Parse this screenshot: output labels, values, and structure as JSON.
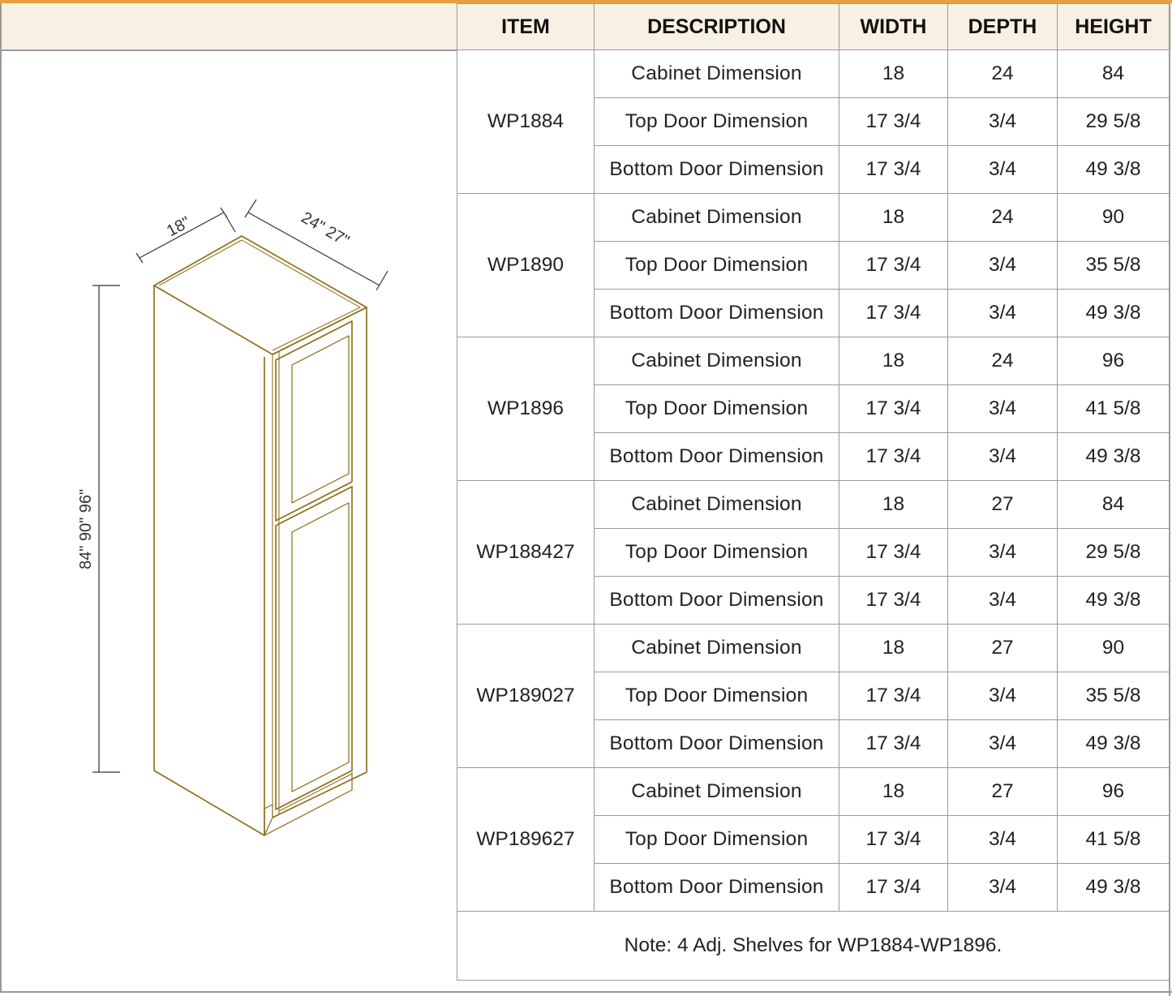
{
  "table": {
    "headers": {
      "item": "ITEM",
      "description": "DESCRIPTION",
      "width": "WIDTH",
      "depth": "DEPTH",
      "height": "HEIGHT"
    },
    "groups": [
      {
        "item": "WP1884",
        "rows": [
          {
            "description": "Cabinet Dimension",
            "width": "18",
            "depth": "24",
            "height": "84"
          },
          {
            "description": "Top Door Dimension",
            "width": "17 3/4",
            "depth": "3/4",
            "height": "29 5/8"
          },
          {
            "description": "Bottom Door Dimension",
            "width": "17 3/4",
            "depth": "3/4",
            "height": "49 3/8"
          }
        ]
      },
      {
        "item": "WP1890",
        "rows": [
          {
            "description": "Cabinet Dimension",
            "width": "18",
            "depth": "24",
            "height": "90"
          },
          {
            "description": "Top Door Dimension",
            "width": "17 3/4",
            "depth": "3/4",
            "height": "35 5/8"
          },
          {
            "description": "Bottom Door Dimension",
            "width": "17 3/4",
            "depth": "3/4",
            "height": "49 3/8"
          }
        ]
      },
      {
        "item": "WP1896",
        "rows": [
          {
            "description": "Cabinet Dimension",
            "width": "18",
            "depth": "24",
            "height": "96"
          },
          {
            "description": "Top Door Dimension",
            "width": "17 3/4",
            "depth": "3/4",
            "height": "41 5/8"
          },
          {
            "description": "Bottom Door Dimension",
            "width": "17 3/4",
            "depth": "3/4",
            "height": "49 3/8"
          }
        ]
      },
      {
        "item": "WP188427",
        "rows": [
          {
            "description": "Cabinet Dimension",
            "width": "18",
            "depth": "27",
            "height": "84"
          },
          {
            "description": "Top Door Dimension",
            "width": "17 3/4",
            "depth": "3/4",
            "height": "29 5/8"
          },
          {
            "description": "Bottom Door Dimension",
            "width": "17 3/4",
            "depth": "3/4",
            "height": "49 3/8"
          }
        ]
      },
      {
        "item": "WP189027",
        "rows": [
          {
            "description": "Cabinet Dimension",
            "width": "18",
            "depth": "27",
            "height": "90"
          },
          {
            "description": "Top Door Dimension",
            "width": "17 3/4",
            "depth": "3/4",
            "height": "35 5/8"
          },
          {
            "description": "Bottom Door Dimension",
            "width": "17 3/4",
            "depth": "3/4",
            "height": "49 3/8"
          }
        ]
      },
      {
        "item": "WP189627",
        "rows": [
          {
            "description": "Cabinet Dimension",
            "width": "18",
            "depth": "27",
            "height": "96"
          },
          {
            "description": "Top Door Dimension",
            "width": "17 3/4",
            "depth": "3/4",
            "height": "41 5/8"
          },
          {
            "description": "Bottom Door Dimension",
            "width": "17 3/4",
            "depth": "3/4",
            "height": "49 3/8"
          }
        ]
      }
    ],
    "note": "Note: 4 Adj. Shelves for WP1884-WP1896."
  },
  "drawing": {
    "width_label": "18\"",
    "depth_label": "24\" 27\"",
    "height_label": "84\" 90\" 96\""
  },
  "colors": {
    "accent": "#e8a03c",
    "header_band": "#f7f0e3",
    "cabinet_outline": "#8a6a12",
    "grid": "#9a9a9a"
  }
}
